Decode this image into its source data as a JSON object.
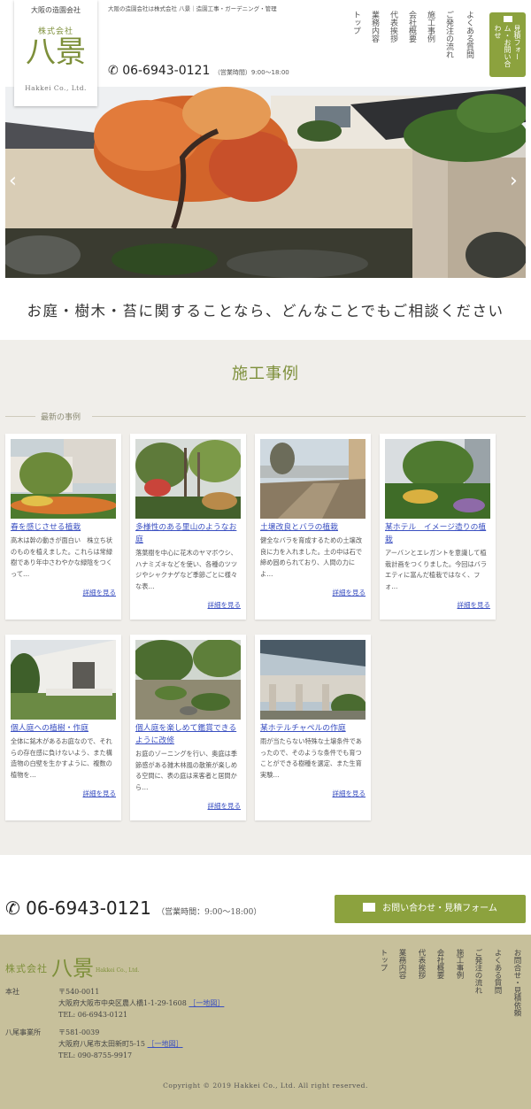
{
  "header": {
    "logo_tag": "大阪の造園会社",
    "logo_company": "株式会社",
    "logo_name": "八景",
    "logo_en": "Hakkei Co., Ltd.",
    "tagline": "大阪の造園会社は株式会社 八景｜造園工事・ガーデニング・管理",
    "phone": "06-6943-0121",
    "hours": "（営業時間）9:00～18:00",
    "nav": [
      "トップ",
      "業務内容",
      "代表挨拶",
      "会社概要",
      "施工事例",
      "ご発注の流れ",
      "よくある質問"
    ],
    "cta": "見積フォーム・お問い合わせ"
  },
  "hero": {
    "prev_icon": "‹",
    "next_icon": "›"
  },
  "catch_copy": "お庭・樹木・苔に関することなら、どんなことでもご相談ください",
  "works": {
    "title": "施工事例",
    "latest_label": "最新の事例",
    "more_label": "詳細を見る",
    "cards": [
      {
        "title": "春を感じさせる植栽",
        "desc": "高木は幹の動きが面白い　株立ち状のものを植えました。これらは常緑樹であり年中さわやかな緑陰をつくって…"
      },
      {
        "title": "多様性のある里山のようなお庭",
        "desc": "落葉樹を中心に花木のヤマボウシ、ハナミズキなどを使い、各種のツツジやシャクナゲなど季節ごとに様々な表…"
      },
      {
        "title": "土壌改良とバラの植栽",
        "desc": "健全なバラを育成するための土壌改良に力を入れました。土の中は石で締め固められており、人間の力によ…"
      },
      {
        "title": "某ホテル　イメージ造りの植栽",
        "desc": "アーバンとエレガントを意識して植栽計画をつくりました。今回はバラエティに富んだ植栽ではなく、フォ…"
      },
      {
        "title": "個人庭への植樹・作庭",
        "desc": "全体に銘木があるお庭なので、それらの存在感に負けないよう、また構造物の白壁を生かすように、複数の植物を…"
      },
      {
        "title": "個人庭を楽しめて鑑賞できるように改修",
        "desc": "お庭のゾーニングを行い、奥庭は季節感がある雑木林風の散策が楽しめる空間に、表の庭は来客者と居間から…"
      },
      {
        "title": "某ホテルチャペルの作庭",
        "desc": "雨が当たらない特殊な土壌条件であったので、そのような条件でも育つことができる樹種を選定、また生育実験…"
      }
    ]
  },
  "contact_bar": {
    "phone": "06-6943-0121",
    "hours": "（営業時間：9:00～18:00）",
    "button": "お問い合わせ・見積フォーム"
  },
  "footer": {
    "logo_company": "株式会社",
    "logo_name": "八景",
    "logo_en": "Hakkei Co., Ltd.",
    "offices": [
      {
        "label": "本社",
        "zip": "〒540-0011",
        "addr": "大阪府大阪市中央区農人橋1-1-29-1608",
        "map": "［一地図］",
        "tel": "TEL: 06-6943-0121"
      },
      {
        "label": "八尾事業所",
        "zip": "〒581-0039",
        "addr": "大阪府八尾市太田新町5-15",
        "map": "［一地図］",
        "tel": "TEL: 090-8755-9917"
      }
    ],
    "nav": [
      "トップ",
      "業務内容",
      "代表挨拶",
      "会社概要",
      "施工事例",
      "ご発注の流れ",
      "よくある質問",
      "お問合せ・見積依頼"
    ],
    "copyright": "Copyright © 2019 Hakkei Co., Ltd. All right reserved."
  },
  "colors": {
    "accent": "#8ca23e",
    "brand": "#7d8f3a",
    "footer_bg": "#c7c09b",
    "section_bg": "#f0eeea",
    "link": "#3a4fc1"
  }
}
